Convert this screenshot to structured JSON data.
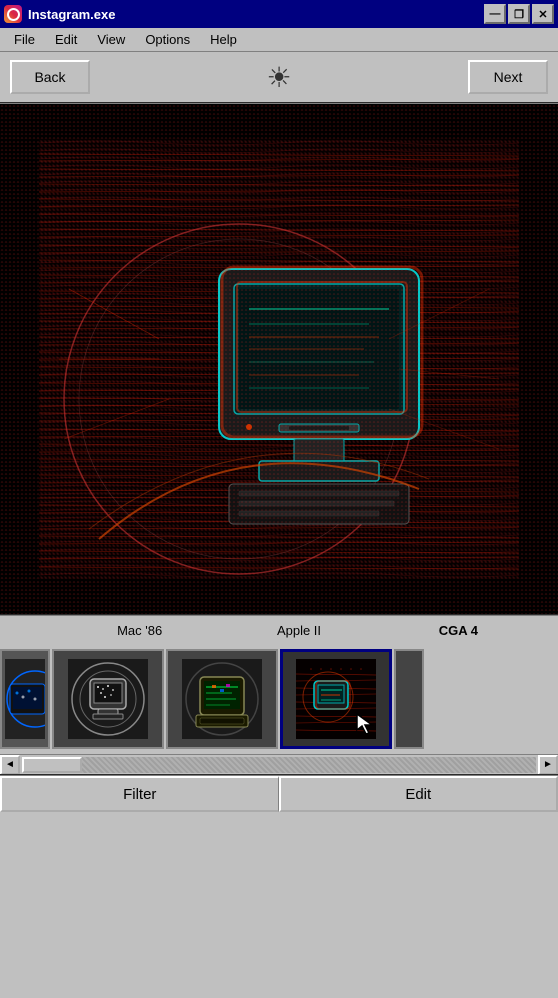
{
  "window": {
    "title": "Instagram.exe",
    "title_color": "#000080"
  },
  "title_buttons": {
    "minimize": "—",
    "restore": "❐",
    "close": "✕"
  },
  "menu": {
    "items": [
      "File",
      "Edit",
      "View",
      "Options",
      "Help"
    ]
  },
  "toolbar": {
    "back_label": "Back",
    "next_label": "Next",
    "sun_icon": "☀"
  },
  "filters": {
    "items": [
      {
        "id": "partial-left",
        "label": "",
        "active": false
      },
      {
        "id": "mac86",
        "label": "Mac '86",
        "active": false
      },
      {
        "id": "apple2",
        "label": "Apple II",
        "active": false
      },
      {
        "id": "cga4",
        "label": "CGA 4",
        "active": true
      }
    ]
  },
  "bottom_buttons": {
    "filter_label": "Filter",
    "edit_label": "Edit"
  },
  "scrollbar": {
    "left_arrow": "◄",
    "right_arrow": "►"
  }
}
